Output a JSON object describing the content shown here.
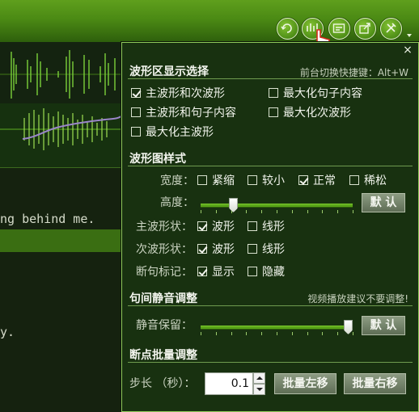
{
  "background_app": {
    "text_line_1": "ng behind me.",
    "text_line_2": "y."
  },
  "toolbar": {
    "icons": [
      "refresh-icon",
      "waveform-icon",
      "subtitle-icon",
      "export-icon",
      "tools-icon"
    ],
    "active_icon": "waveform-icon"
  },
  "panel": {
    "close_label": "×",
    "waveform_display": {
      "title": "波形区显示选择",
      "hotkey_note": "前台切换快捷键：Alt+W",
      "options": [
        {
          "label": "主波形和次波形",
          "checked": true
        },
        {
          "label": "最大化句子内容",
          "checked": false
        },
        {
          "label": "主波形和句子内容",
          "checked": false
        },
        {
          "label": "最大化次波形",
          "checked": false
        },
        {
          "label": "最大化主波形",
          "checked": false
        }
      ]
    },
    "waveform_style": {
      "title": "波形图样式",
      "width_label": "宽度：",
      "width_options": [
        {
          "label": "紧缩",
          "checked": false
        },
        {
          "label": "较小",
          "checked": false
        },
        {
          "label": "正常",
          "checked": true
        },
        {
          "label": "稀松",
          "checked": false
        }
      ],
      "height_label": "高度：",
      "height_value": 0.2,
      "height_default_button": "默 认",
      "main_shape_label": "主波形状：",
      "main_shape_options": [
        {
          "label": "波形",
          "checked": true
        },
        {
          "label": "线形",
          "checked": false
        }
      ],
      "sub_shape_label": "次波形状：",
      "sub_shape_options": [
        {
          "label": "波形",
          "checked": true
        },
        {
          "label": "线形",
          "checked": false
        }
      ],
      "break_mark_label": "断句标记：",
      "break_mark_options": [
        {
          "label": "显示",
          "checked": true
        },
        {
          "label": "隐藏",
          "checked": false
        }
      ]
    },
    "silence": {
      "title": "句间静音调整",
      "note": "视频播放建议不要调整!",
      "keep_label": "静音保留：",
      "keep_value": 1.0,
      "default_button": "默 认"
    },
    "batch": {
      "title": "断点批量调整",
      "step_label": "步长 （秒）：",
      "step_value": "0.1",
      "left_button": "批量左移",
      "right_button": "批量右移"
    }
  },
  "colors": {
    "accent_green": "#5aa419",
    "panel_bg": "#183110",
    "button_gray": "#7c8b72"
  }
}
